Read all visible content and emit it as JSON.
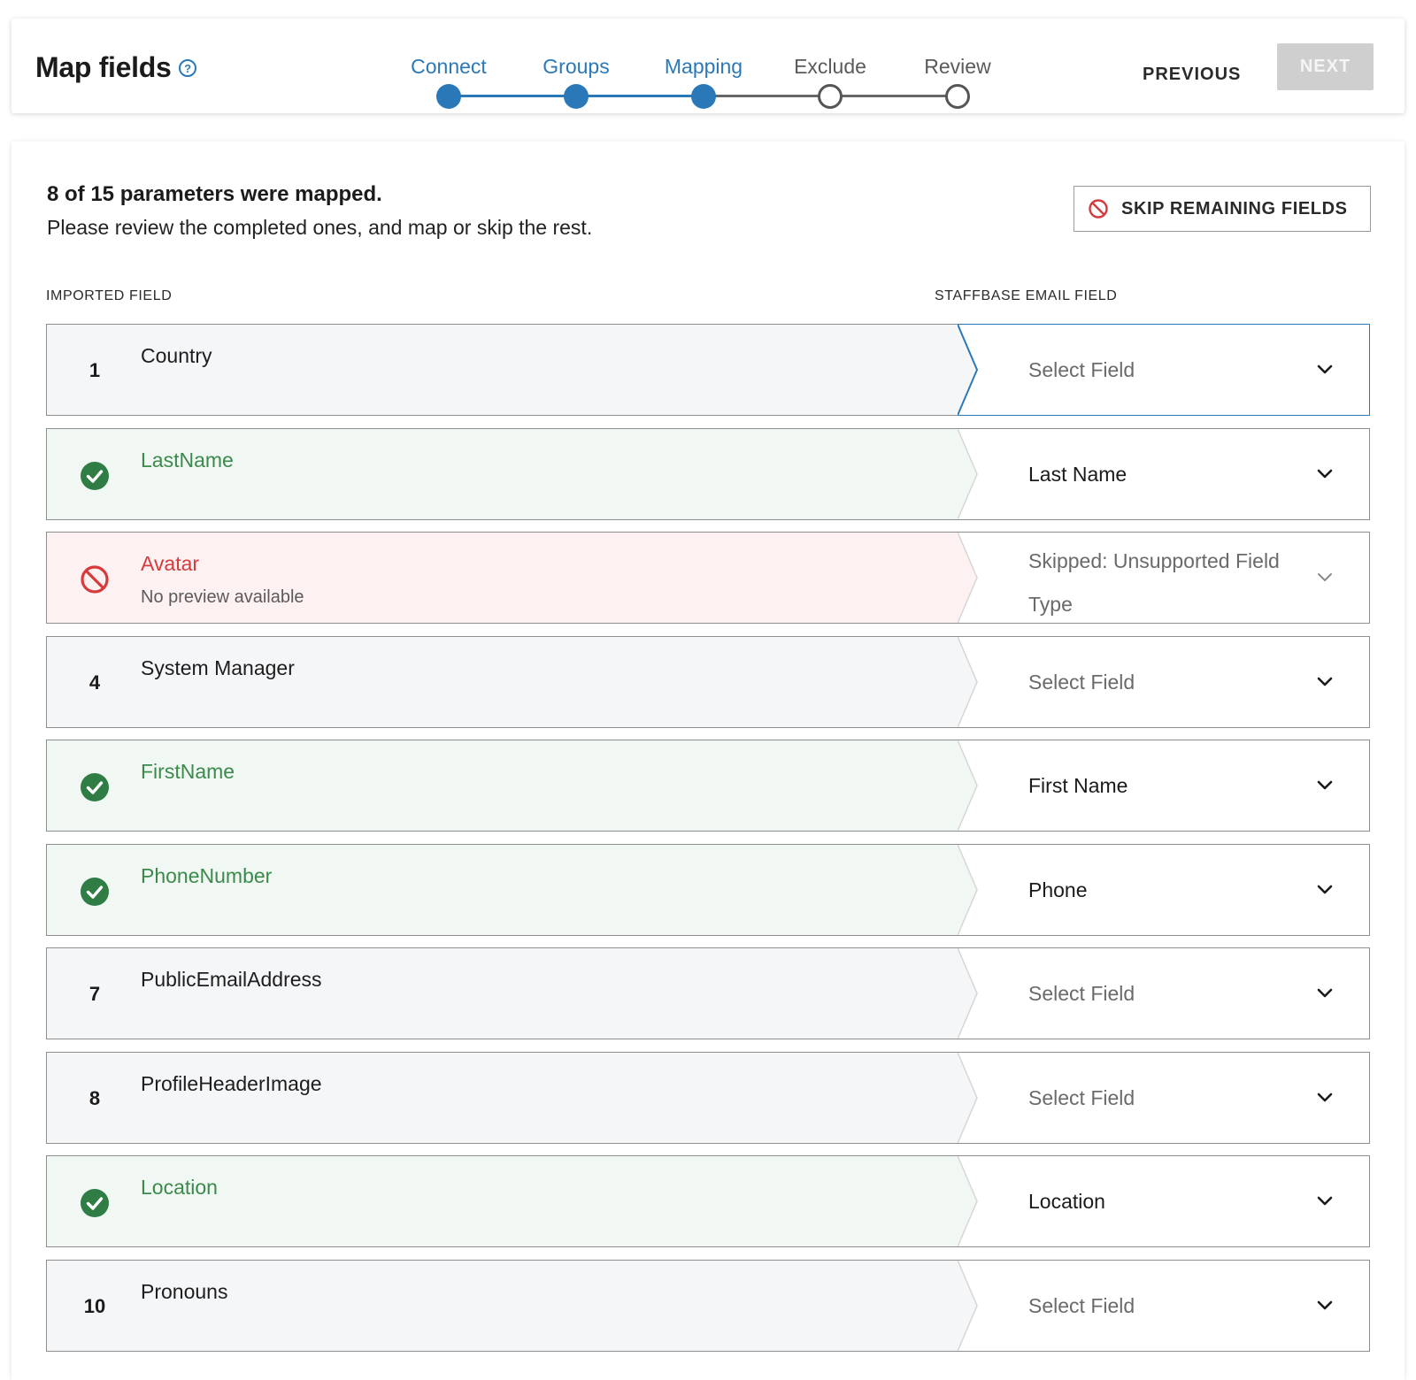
{
  "header": {
    "title": "Map fields",
    "steps": [
      {
        "label": "Connect",
        "done": true
      },
      {
        "label": "Groups",
        "done": true
      },
      {
        "label": "Mapping",
        "done": true
      },
      {
        "label": "Exclude",
        "done": false
      },
      {
        "label": "Review",
        "done": false
      }
    ],
    "previous_label": "PREVIOUS",
    "next_label": "NEXT"
  },
  "summary": {
    "title": "8 of 15 parameters were mapped.",
    "text": "Please review the completed ones, and map or skip the rest.",
    "skip_button": "SKIP REMAINING FIELDS"
  },
  "columns": {
    "imported": "IMPORTED FIELD",
    "staffbase": "STAFFBASE EMAIL FIELD"
  },
  "rows": [
    {
      "status": "unmapped",
      "index": "1",
      "field": "Country",
      "sub": "",
      "select": "Select Field",
      "active": true
    },
    {
      "status": "mapped",
      "index": "",
      "field": "LastName",
      "sub": "",
      "select": "Last Name"
    },
    {
      "status": "skipped",
      "index": "",
      "field": "Avatar",
      "sub": "No preview available",
      "select": "Skipped: Unsupported Field Type"
    },
    {
      "status": "unmapped",
      "index": "4",
      "field": "System Manager",
      "sub": "",
      "select": "Select Field"
    },
    {
      "status": "mapped",
      "index": "",
      "field": "FirstName",
      "sub": "",
      "select": "First Name"
    },
    {
      "status": "mapped",
      "index": "",
      "field": "PhoneNumber",
      "sub": "",
      "select": "Phone"
    },
    {
      "status": "unmapped",
      "index": "7",
      "field": "PublicEmailAddress",
      "sub": "",
      "select": "Select Field"
    },
    {
      "status": "unmapped",
      "index": "8",
      "field": "ProfileHeaderImage",
      "sub": "",
      "select": "Select Field"
    },
    {
      "status": "mapped",
      "index": "",
      "field": "Location",
      "sub": "",
      "select": "Location"
    },
    {
      "status": "unmapped",
      "index": "10",
      "field": "Pronouns",
      "sub": "",
      "select": "Select Field"
    }
  ],
  "colors": {
    "accent": "#2b78b8",
    "mapped_green": "#3b8a4c",
    "skipped_red": "#d63a3a"
  }
}
